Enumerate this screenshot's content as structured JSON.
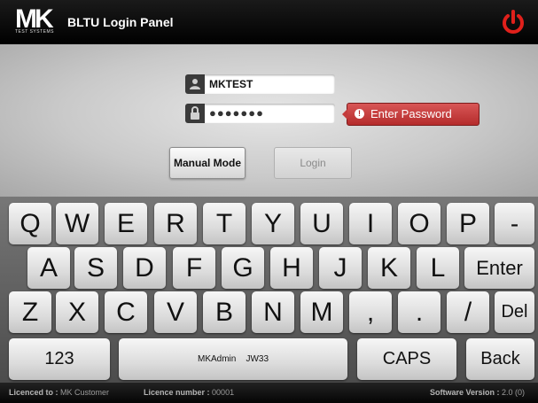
{
  "header": {
    "logo_text": "MK",
    "logo_subtext": "TEST SYSTEMS",
    "title": "BLTU Login Panel",
    "power_icon": "power-icon",
    "power_color": "#e0201b"
  },
  "login": {
    "username_value": "MKTEST",
    "username_icon": "user-icon",
    "password_value": "●●●●●●●",
    "password_icon": "lock-icon",
    "error_icon": "alert-icon",
    "error_text": "Enter Password",
    "error_color": "#c43c3c",
    "manual_mode_label": "Manual Mode",
    "login_label": "Login"
  },
  "keyboard": {
    "row1": [
      "Q",
      "W",
      "E",
      "R",
      "T",
      "Y",
      "U",
      "I",
      "O",
      "P",
      "-"
    ],
    "row2": [
      "A",
      "S",
      "D",
      "F",
      "G",
      "H",
      "J",
      "K",
      "L",
      "Enter"
    ],
    "row3": [
      "Z",
      "X",
      "C",
      "V",
      "B",
      "N",
      "M",
      ",",
      ".",
      "/",
      "Del"
    ],
    "row4": [
      "123",
      "MKAdmin    JW33",
      "CAPS",
      "Back"
    ]
  },
  "footer": {
    "licenced_label": "Licenced to :",
    "licenced_value": "MK Customer",
    "licence_number_label": "Licence number :",
    "licence_number_value": "00001",
    "software_version_label": "Software Version :",
    "software_version_value": "2.0 (0)"
  }
}
